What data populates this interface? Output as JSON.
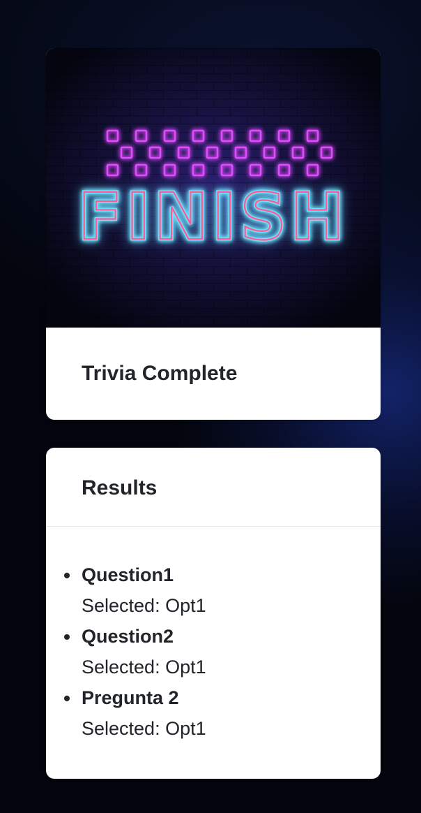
{
  "hero": {
    "sign_text": "FINISH",
    "alt": "FINISH"
  },
  "finish_card": {
    "title": "Trivia Complete"
  },
  "results_card": {
    "title": "Results",
    "selected_prefix": "Selected:",
    "items": [
      {
        "question": "Question1",
        "selected": "Opt1"
      },
      {
        "question": "Question2",
        "selected": "Opt1"
      },
      {
        "question": "Pregunta 2",
        "selected": "Opt1"
      }
    ]
  },
  "colors": {
    "neon_magenta": "#e04cff",
    "neon_pink": "#ff4f8a",
    "neon_cyan": "#5fd4ff",
    "card_bg": "#ffffff",
    "page_bg": "#03050c"
  }
}
